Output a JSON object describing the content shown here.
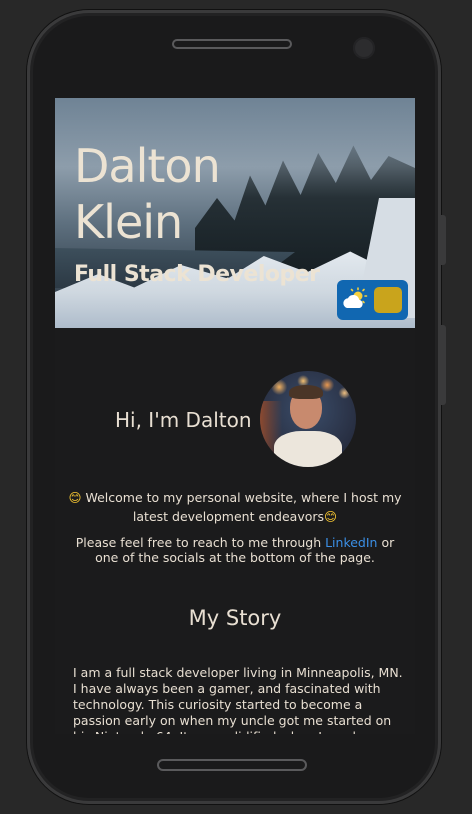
{
  "hero": {
    "name": "Dalton Klein",
    "subtitle": "Full Stack Developer"
  },
  "theme_toggle": {
    "icon": "partly-cloudy-icon",
    "accent": "#1167b1",
    "knob_color": "#c9a41c"
  },
  "intro": {
    "greeting": "Hi, I'm Dalton"
  },
  "welcome": {
    "emoji": "😊",
    "text": "Welcome to my personal website, where I host my latest development endeavors"
  },
  "contact": {
    "before": "Please feel free to reach to me through ",
    "link": "LinkedIn",
    "after": " or one of the socials at the bottom of the page."
  },
  "story": {
    "title": "My Story",
    "body": "I am a full stack developer living in Minneapolis, MN. I have always been a gamer, and fascinated with technology. This curiosity started to become a passion early on when my uncle got me started on his Nintendo 64. It was solidified when I used FrostWire to"
  },
  "colors": {
    "background": "#1b1b1c",
    "text": "#e8dfd2",
    "link": "#3b8fe5"
  }
}
